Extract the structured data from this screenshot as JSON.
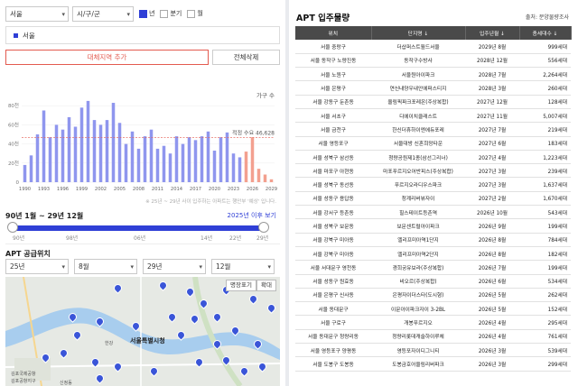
{
  "filters": {
    "region_select": "서울",
    "district_select": "시/구/군",
    "toggles": [
      {
        "label": "년",
        "checked": true
      },
      {
        "label": "분기",
        "checked": false
      },
      {
        "label": "월",
        "checked": false
      }
    ]
  },
  "selected_region_tag": "서울",
  "buttons": {
    "add_region": "대체지역 추가",
    "clear_all": "전체삭제"
  },
  "chart_data": {
    "type": "bar",
    "legend": "가구 수",
    "reference_label": "적정 수요 46,628",
    "reference_value": 46628,
    "ylim": [
      0,
      100000
    ],
    "y_ticks": [
      "0",
      "20천",
      "40천",
      "60천",
      "80천"
    ],
    "x_tick_labels": [
      "1990",
      "1993",
      "1996",
      "1999",
      "2002",
      "2005",
      "2008",
      "2011",
      "2014",
      "2017",
      "2020",
      "2023",
      "2026",
      "2029"
    ],
    "categories": [
      1990,
      1991,
      1992,
      1993,
      1994,
      1995,
      1996,
      1997,
      1998,
      1999,
      2000,
      2001,
      2002,
      2003,
      2004,
      2005,
      2006,
      2007,
      2008,
      2009,
      2010,
      2011,
      2012,
      2013,
      2014,
      2015,
      2016,
      2017,
      2018,
      2019,
      2020,
      2021,
      2022,
      2023,
      2024,
      2025,
      2026,
      2027,
      2028,
      2029
    ],
    "values": [
      18000,
      28000,
      50000,
      75000,
      47000,
      60000,
      55000,
      68000,
      58000,
      78000,
      85000,
      65000,
      60000,
      65000,
      83000,
      62000,
      40000,
      53000,
      35000,
      48000,
      55000,
      35000,
      38000,
      30000,
      48000,
      40000,
      47000,
      44000,
      48000,
      53000,
      33000,
      47000,
      52000,
      30000,
      26000,
      32000,
      47000,
      14000,
      8000,
      3000
    ],
    "projected_from": 2025
  },
  "chart_note": "※ 25년 ~ 29년 사이 입주하는 아파트는 행안부 '예상' 입니다.",
  "range": {
    "title": "90년 1월 ~ 29년 12월",
    "link": "2025년 이후 보기",
    "ticks": [
      "90년",
      "98년",
      "06년",
      "14년",
      "22년",
      "29년"
    ],
    "start_fraction": 0.0,
    "end_fraction": 1.0
  },
  "supply": {
    "title": "APT 공급위치",
    "selects": [
      "25년",
      "8월",
      "29년",
      "12월"
    ]
  },
  "map": {
    "buttons": [
      "명장표기",
      "확대"
    ],
    "city_label": "서울특별시청",
    "place_labels": [
      "김포국제공항",
      "김포공항지구",
      "신정동",
      "한강"
    ]
  },
  "right": {
    "title": "APT 입주물량",
    "source": "출처: 분양물량조사",
    "headers": [
      "위치",
      "단지명 ↓",
      "입주년월 ↓",
      "총세대수 ↓"
    ],
    "rows": [
      [
        "서울 중랑구",
        "더샵퍼스트월드서울",
        "2029년 8월",
        "999세대"
      ],
      [
        "서울 동작구 노량진동",
        "동작구수방사",
        "2028년 12월",
        "556세대"
      ],
      [
        "서울 노원구",
        "서울원아이파크",
        "2028년 7월",
        "2,264세대"
      ],
      [
        "서울 은평구",
        "연신내양우내안에퍼스티지",
        "2028년 3월",
        "260세대"
      ],
      [
        "서울 강동구 둔촌동",
        "올림픽파크포레온(주상복합)",
        "2027년 12월",
        "128세대"
      ],
      [
        "서울 서초구",
        "디에이치클래스트",
        "2027년 11월",
        "5,007세대"
      ],
      [
        "서울 금천구",
        "한신더휴하이엔에듀포레",
        "2027년 7월",
        "219세대"
      ],
      [
        "서울 영등포구",
        "서울대방 신혼희망타운",
        "2027년 6월",
        "183세대"
      ],
      [
        "서울 성북구 삼선동",
        "청량공원제1종(삼선그리너)",
        "2027년 4월",
        "1,223세대"
      ],
      [
        "서울 마포구 아현동",
        "마포푸르지오어반피스(주상복합)",
        "2027년 3월",
        "239세대"
      ],
      [
        "서울 성북구 동선동",
        "푸르지오라디우스파크",
        "2027년 3월",
        "1,637세대"
      ],
      [
        "서울 성동구 용답동",
        "청계리버뷰자이",
        "2027년 2월",
        "1,670세대"
      ],
      [
        "서울 강서구 등촌동",
        "힐스테이트등촌역",
        "2026년 10월",
        "543세대"
      ],
      [
        "서울 성북구 보문동",
        "보문센트럴아이파크",
        "2026년 9월",
        "199세대"
      ],
      [
        "서울 강북구 미아동",
        "엘리프미아역1단지",
        "2026년 8월",
        "784세대"
      ],
      [
        "서울 강북구 미아동",
        "엘리프미아역2단지",
        "2026년 8월",
        "182세대"
      ],
      [
        "서울 서대문구 영천동",
        "경희궁유보라(주상복합)",
        "2026년 7월",
        "199세대"
      ],
      [
        "서울 성동구 원효동",
        "비오르(주상복합)",
        "2026년 6월",
        "534세대"
      ],
      [
        "서울 은평구 신사동",
        "은평자이더스타(도시형)",
        "2026년 5월",
        "262세대"
      ],
      [
        "서울 동대문구",
        "이문아이파크자이 3-2BL",
        "2026년 5월",
        "152세대"
      ],
      [
        "서울 구로구",
        "개봉푸르지오",
        "2026년 4월",
        "295세대"
      ],
      [
        "서울 동대문구 청량리동",
        "청량리롯데캐슬하이루체",
        "2026년 4월",
        "761세대"
      ],
      [
        "서울 영등포구 양평동",
        "영등포자이디그니티",
        "2026년 3월",
        "539세대"
      ],
      [
        "서울 도봉구 도봉동",
        "도봉금호어울림리버파크",
        "2026년 3월",
        "299세대"
      ]
    ]
  }
}
